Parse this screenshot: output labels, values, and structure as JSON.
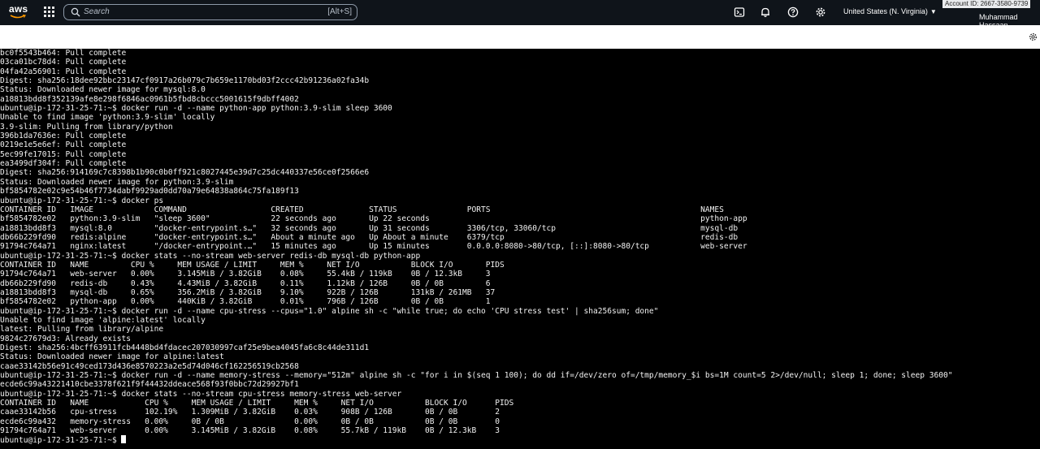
{
  "topbar": {
    "logo_text": "aws",
    "search_placeholder": "Search",
    "search_shortcut": "[Alt+S]",
    "region": "United States (N. Virginia)",
    "account_id": "Account ID: 2667-3580-9739",
    "user_name": "Muhammad Hassaan",
    "icons": [
      "services-grid-icon",
      "search-icon",
      "cloudshell-icon",
      "notifications-bell-icon",
      "help-icon",
      "settings-gear-icon",
      "caret-down-icon"
    ]
  },
  "subbar": {
    "icons": [
      "settings-cog-icon"
    ]
  },
  "terminal": {
    "lines": [
      "bc0f5543b464: Pull complete",
      "03ca01bc78d4: Pull complete",
      "04fa42a56901: Pull complete",
      "Digest: sha256:18dee92bbc23147cf0917a26b079c7b659e1170bd03f2ccc42b91236a02fa34b",
      "Status: Downloaded newer image for mysql:8.0",
      "a18813bdd8f352139afe8e298f6846ac0961b5fbd8cbccc5001615f9dbff4002",
      "ubuntu@ip-172-31-25-71:~$ docker run -d --name python-app python:3.9-slim sleep 3600",
      "Unable to find image 'python:3.9-slim' locally",
      "3.9-slim: Pulling from library/python",
      "396b1da7636e: Pull complete",
      "0219e1e5e6ef: Pull complete",
      "5ec99fe17015: Pull complete",
      "ea3499df304f: Pull complete",
      "Digest: sha256:914169c7c8398b1b90c0b0ff921c8027445e39d7c25dc440337e56ce0f2566e6",
      "Status: Downloaded newer image for python:3.9-slim",
      "bf5854782e02c9e54b46f7734dabf9929ad0dd70a79e64838a864c75fa189f13",
      "ubuntu@ip-172-31-25-71:~$ docker ps",
      "CONTAINER ID   IMAGE             COMMAND                  CREATED              STATUS               PORTS                                             NAMES",
      "bf5854782e02   python:3.9-slim   \"sleep 3600\"             22 seconds ago       Up 22 seconds                                                          python-app",
      "a18813bdd8f3   mysql:8.0         \"docker-entrypoint.s…\"   32 seconds ago       Up 31 seconds        3306/tcp, 33060/tcp                               mysql-db",
      "db66b229fd90   redis:alpine      \"docker-entrypoint.s…\"   About a minute ago   Up About a minute    6379/tcp                                          redis-db",
      "91794c764a71   nginx:latest      \"/docker-entrypoint.…\"   15 minutes ago       Up 15 minutes        0.0.0.0:8080->80/tcp, [::]:8080->80/tcp           web-server",
      "ubuntu@ip-172-31-25-71:~$ docker stats --no-stream web-server redis-db mysql-db python-app",
      "CONTAINER ID   NAME         CPU %     MEM USAGE / LIMIT     MEM %     NET I/O           BLOCK I/O       PIDS",
      "91794c764a71   web-server   0.00%     3.145MiB / 3.82GiB    0.08%     55.4kB / 119kB    0B / 12.3kB     3",
      "db66b229fd90   redis-db     0.43%     4.43MiB / 3.82GiB     0.11%     1.12kB / 126B     0B / 0B         6",
      "a18813bdd8f3   mysql-db     0.65%     356.2MiB / 3.82GiB    9.10%     922B / 126B       131kB / 261MB   37",
      "bf5854782e02   python-app   0.00%     440KiB / 3.82GiB      0.01%     796B / 126B       0B / 0B         1",
      "ubuntu@ip-172-31-25-71:~$ docker run -d --name cpu-stress --cpus=\"1.0\" alpine sh -c \"while true; do echo 'CPU stress test' | sha256sum; done\"",
      "Unable to find image 'alpine:latest' locally",
      "latest: Pulling from library/alpine",
      "9824c27679d3: Already exists",
      "Digest: sha256:4bcff63911fcb4448bd4fdacec207030997caf25e9bea4045fa6c8c44de311d1",
      "Status: Downloaded newer image for alpine:latest",
      "caae33142b56e91c49ced173d436e8570223a2e5d74d046cf162256519cb2568",
      "ubuntu@ip-172-31-25-71:~$ docker run -d --name memory-stress --memory=\"512m\" alpine sh -c \"for i in $(seq 1 100); do dd if=/dev/zero of=/tmp/memory_$i bs=1M count=5 2>/dev/null; sleep 1; done; sleep 3600\"",
      "ecde6c99a43221410cbe3378f621f9f44432ddeace568f93f0bbc72d29927bf1",
      "ubuntu@ip-172-31-25-71:~$ docker stats --no-stream cpu-stress memory-stress web-server",
      "CONTAINER ID   NAME            CPU %     MEM USAGE / LIMIT     MEM %     NET I/O           BLOCK I/O      PIDS",
      "caae33142b56   cpu-stress      102.19%   1.309MiB / 3.82GiB    0.03%     908B / 126B       0B / 0B        2",
      "ecde6c99a432   memory-stress   0.00%     0B / 0B               0.00%     0B / 0B           0B / 0B        0",
      "91794c764a71   web-server      0.00%     3.145MiB / 3.82GiB    0.08%     55.7kB / 119kB    0B / 12.3kB    3"
    ],
    "prompt": "ubuntu@ip-172-31-25-71:~$ "
  }
}
